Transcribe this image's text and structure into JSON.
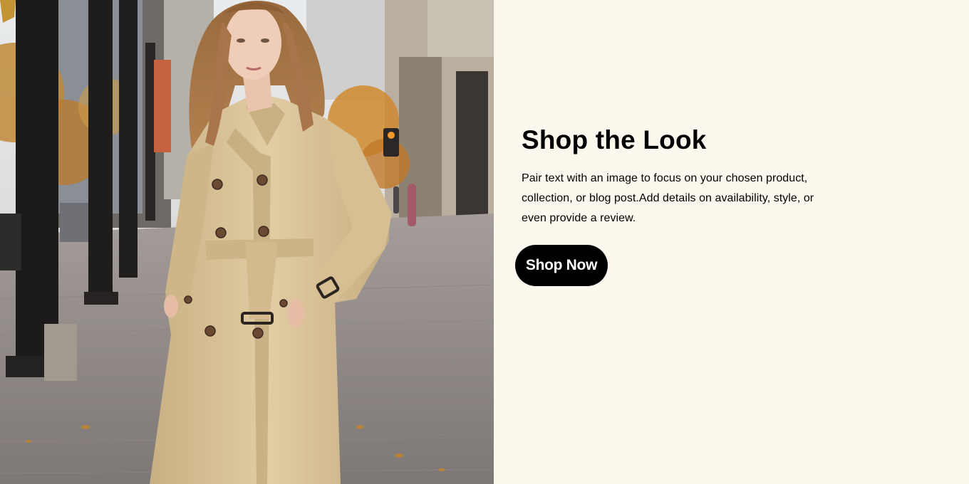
{
  "hero": {
    "image_subject": "Woman in a belted beige double-breasted trench coat standing on a city sidewalk in autumn"
  },
  "content": {
    "title": "Shop the Look",
    "description": "Pair text with an image to focus on your chosen product, collection, or blog post.Add details on availability, style, or even provide a review.",
    "button_label": "Shop Now"
  },
  "colors": {
    "background": "#fcf8ee",
    "button": "#000000",
    "button_text": "#ffffff",
    "coat": "#d8c198"
  }
}
